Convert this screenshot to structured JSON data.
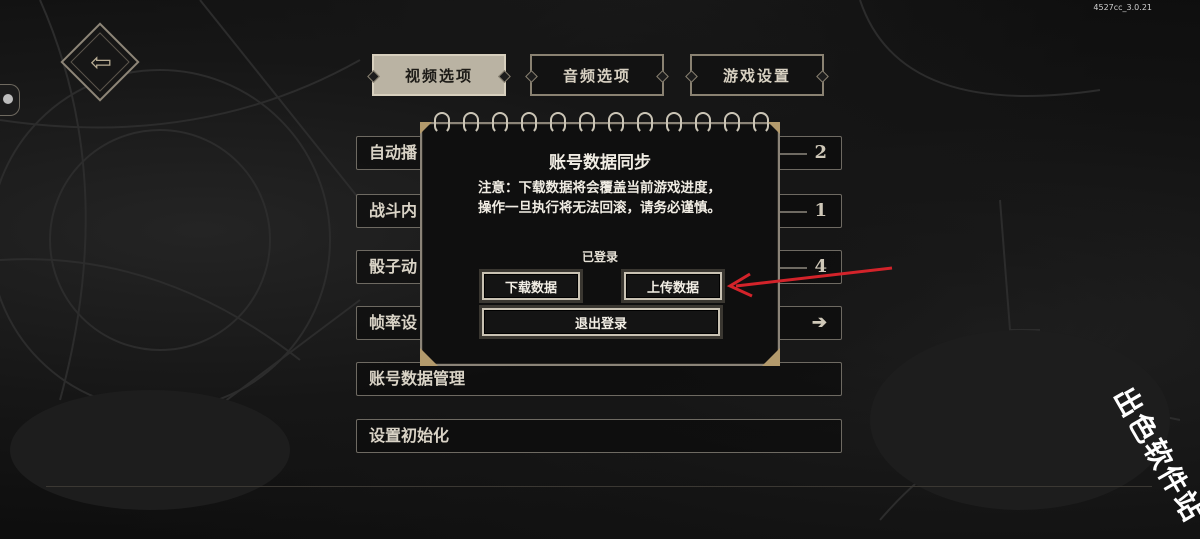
{
  "version": "4527cc_3.0.21",
  "tabs": [
    {
      "label": "视频选项",
      "active": true
    },
    {
      "label": "音频选项",
      "active": false
    },
    {
      "label": "游戏设置",
      "active": false
    }
  ],
  "settings_rows": [
    {
      "label": "自动播",
      "value": "2"
    },
    {
      "label": "战斗内",
      "value": "1"
    },
    {
      "label": "骰子动",
      "value": "4"
    },
    {
      "label": "帧率设",
      "value": ""
    },
    {
      "label": "账号数据管理",
      "value": ""
    },
    {
      "label": "设置初始化",
      "value": ""
    }
  ],
  "dialog": {
    "title": "账号数据同步",
    "notice": "注意：下载数据将会覆盖当前游戏进度，操作一旦执行将无法回滚，请务必谨慎。",
    "status": "已登录",
    "download_label": "下载数据",
    "upload_label": "上传数据",
    "logout_label": "退出登录"
  },
  "watermark": "出色软件站",
  "colors": {
    "annotation_arrow": "#d3232a",
    "gold_accent": "#b39a6c",
    "tab_active_bg": "#bab3a3"
  }
}
